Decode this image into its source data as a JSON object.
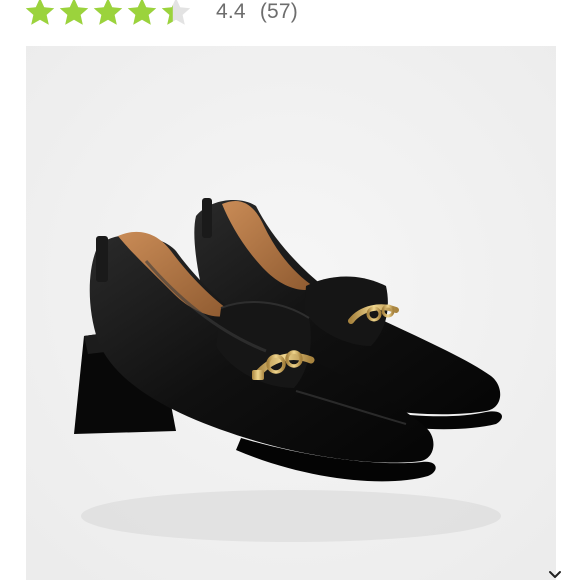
{
  "rating": {
    "value": 4.4,
    "score_text": "4.4",
    "count_text": "(57)",
    "max_stars": 5,
    "star_color": "#9bd33c",
    "empty_star_color": "#e3e3e3"
  },
  "product_image": {
    "background": "#f1f1f1",
    "shoe_color": "#111111",
    "hardware_color": "#c9a55a"
  },
  "icons": {
    "scroll": "chevron-down-icon"
  }
}
